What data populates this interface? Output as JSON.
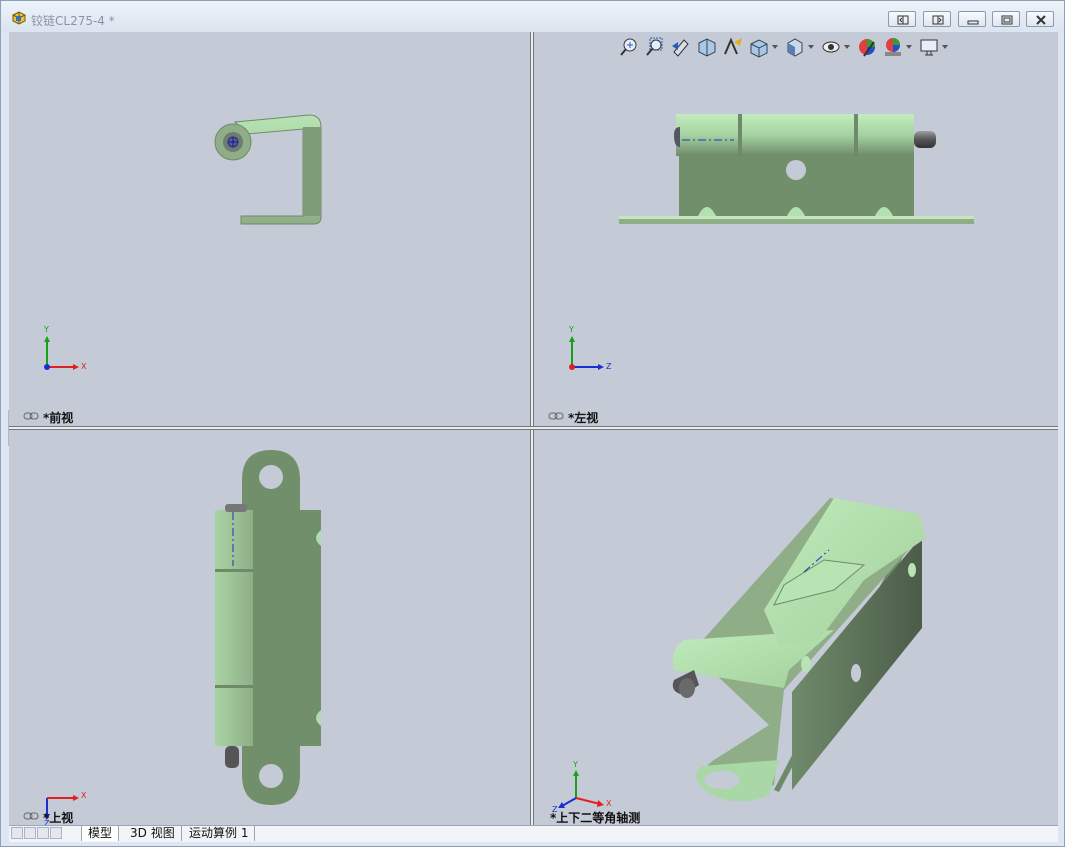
{
  "window": {
    "title": "铰链CL275-4 *"
  },
  "colors": {
    "viewport_bg": "#c5cbd6",
    "part_light": "#a9d8a6",
    "part_mid": "#8fae87",
    "part_dark": "#6f8a6a",
    "axis_x": "#e02020",
    "axis_y": "#18a018",
    "axis_z": "#1a2fd0"
  },
  "toolbar": {
    "icons": [
      "zoom-to-fit-icon",
      "zoom-area-icon",
      "previous-view-icon",
      "section-view-icon",
      "dynamic-annotation-icon",
      "view-orientation-icon",
      "display-style-icon",
      "hide-show-icon",
      "edit-appearance-icon",
      "apply-scene-icon",
      "view-settings-icon"
    ]
  },
  "views": [
    {
      "label": "*前视",
      "axes": {
        "h": "X",
        "v": "Y"
      }
    },
    {
      "label": "*左视",
      "axes": {
        "h": "Z",
        "v": "Y"
      }
    },
    {
      "label": "*上视",
      "axes": {
        "h": "X",
        "v": "Z"
      }
    },
    {
      "label": "*上下二等角轴测",
      "axes": {
        "h": "X",
        "v": "Y",
        "d": "Z"
      }
    }
  ],
  "tabs": [
    {
      "label": "模型",
      "active": true
    },
    {
      "label": "3D 视图",
      "active": false
    },
    {
      "label": "运动算例 1",
      "active": false
    }
  ]
}
